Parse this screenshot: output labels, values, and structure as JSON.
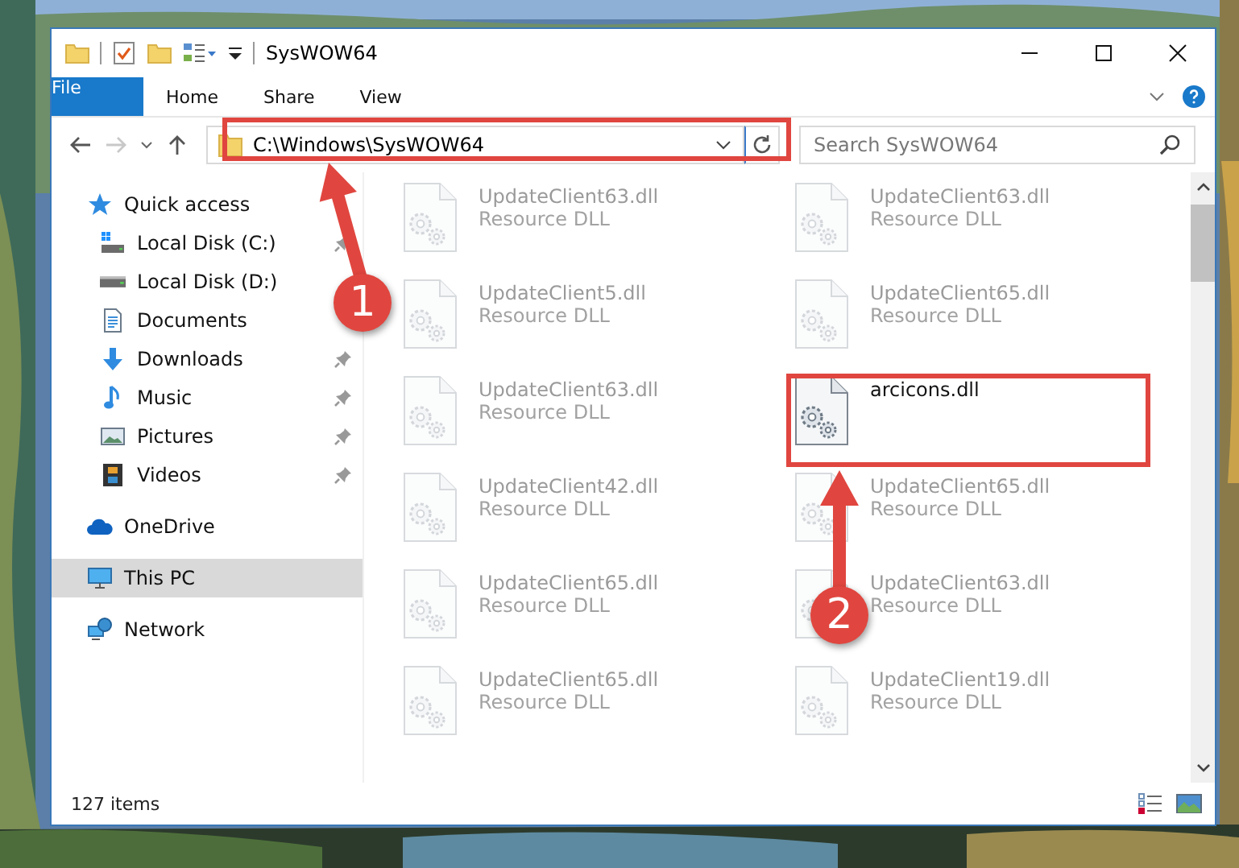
{
  "window": {
    "title": "SysWOW64"
  },
  "ribbon_tabs": [
    {
      "label": "File",
      "kind": "file"
    },
    {
      "label": "Home",
      "kind": "tab"
    },
    {
      "label": "Share",
      "kind": "tab"
    },
    {
      "label": "View",
      "kind": "tab"
    }
  ],
  "address": {
    "path": "C:\\Windows\\SysWOW64"
  },
  "search": {
    "placeholder": "Search SysWOW64"
  },
  "nav": [
    {
      "label": "Quick access",
      "kind": "star",
      "selected": false,
      "children": [
        {
          "label": "Local Disk (C:)",
          "kind": "windrive",
          "pinned": true
        },
        {
          "label": "Local Disk (D:)",
          "kind": "drive",
          "pinned": false
        },
        {
          "label": "Documents",
          "kind": "documents",
          "pinned": false
        },
        {
          "label": "Downloads",
          "kind": "downloads",
          "pinned": true
        },
        {
          "label": "Music",
          "kind": "music",
          "pinned": true
        },
        {
          "label": "Pictures",
          "kind": "pictures",
          "pinned": true
        },
        {
          "label": "Videos",
          "kind": "videos",
          "pinned": true
        }
      ]
    },
    {
      "label": "OneDrive",
      "kind": "cloud",
      "selected": false
    },
    {
      "label": "This PC",
      "kind": "pc",
      "selected": true
    },
    {
      "label": "Network",
      "kind": "network",
      "selected": false
    }
  ],
  "files": [
    {
      "name": "UpdateClient63.dll",
      "type": "Resource DLL",
      "faded": true
    },
    {
      "name": "UpdateClient63.dll",
      "type": "Resource DLL",
      "faded": true
    },
    {
      "name": "UpdateClient5.dll",
      "type": "Resource DLL",
      "faded": true
    },
    {
      "name": "UpdateClient65.dll",
      "type": "Resource DLL",
      "faded": true
    },
    {
      "name": "UpdateClient63.dll",
      "type": "Resource DLL",
      "faded": true
    },
    {
      "name": "arcicons.dll",
      "faded": false
    },
    {
      "name": "UpdateClient42.dll",
      "type": "Resource DLL",
      "faded": true
    },
    {
      "name": "UpdateClient65.dll",
      "type": "Resource DLL",
      "faded": true
    },
    {
      "name": "UpdateClient65.dll",
      "type": "Resource DLL",
      "faded": true
    },
    {
      "name": "UpdateClient63.dll",
      "type": "Resource DLL",
      "faded": true
    },
    {
      "name": "UpdateClient65.dll",
      "type": "Resource DLL",
      "faded": true
    },
    {
      "name": "UpdateClient19.dll",
      "type": "Resource DLL",
      "faded": true
    }
  ],
  "status_bar": {
    "item_count": "127 items"
  },
  "annotations": [
    {
      "number": "1"
    },
    {
      "number": "2"
    }
  ]
}
